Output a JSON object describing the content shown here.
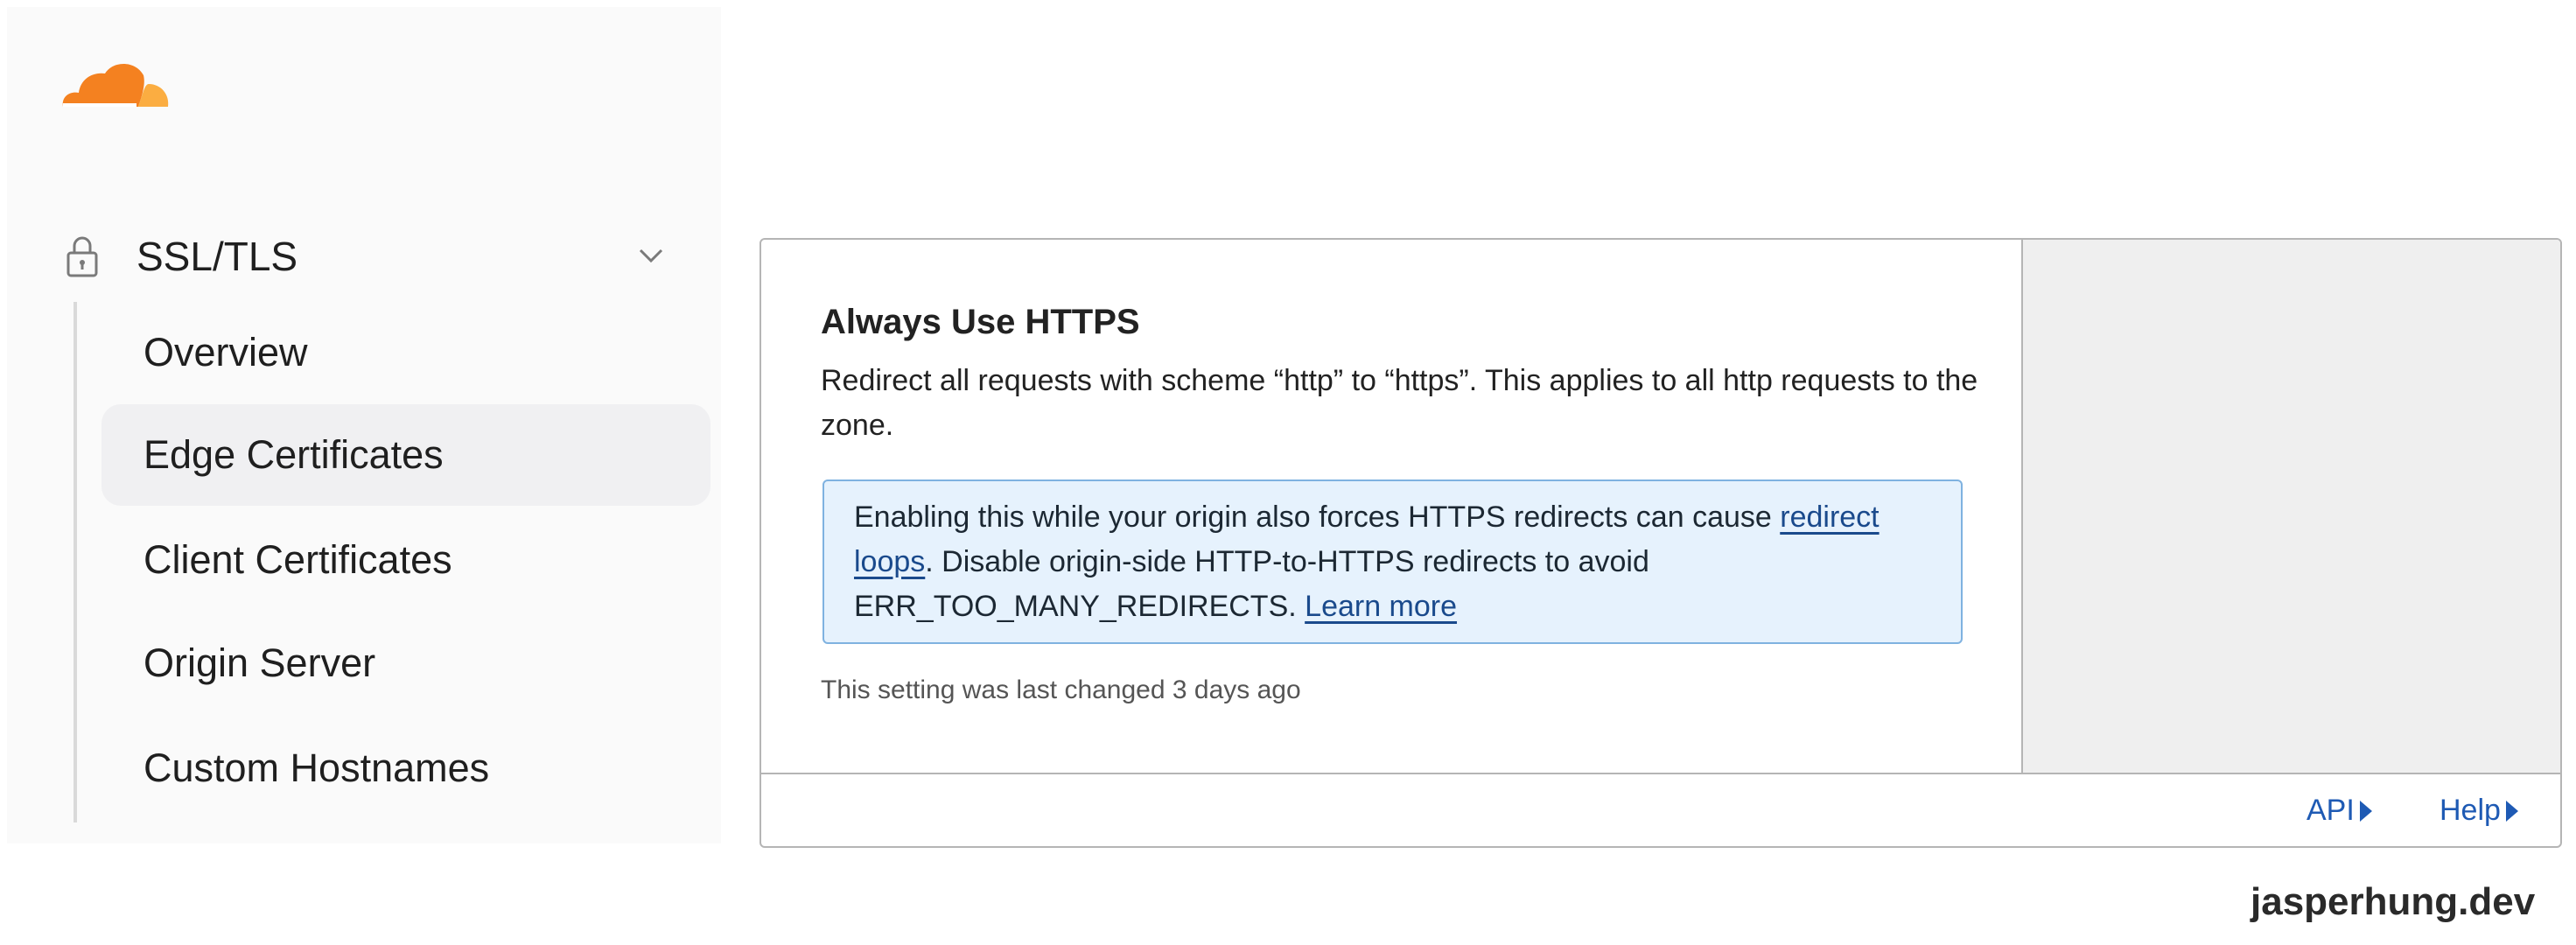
{
  "sidebar": {
    "section_label": "SSL/TLS",
    "items": [
      {
        "label": "Overview",
        "active": false
      },
      {
        "label": "Edge Certificates",
        "active": true
      },
      {
        "label": "Client Certificates",
        "active": false
      },
      {
        "label": "Origin Server",
        "active": false
      },
      {
        "label": "Custom Hostnames",
        "active": false
      }
    ]
  },
  "card": {
    "title": "Always Use HTTPS",
    "description": "Redirect all requests with scheme “http” to “https”. This applies to all http requests to the zone.",
    "callout": {
      "text_before": "Enabling this while your origin also forces HTTPS redirects can cause ",
      "link1": "redirect loops",
      "text_middle": ". Disable origin-side HTTP-to-HTTPS redirects to avoid ERR_TOO_MANY_REDIRECTS. ",
      "link2": "Learn more"
    },
    "last_changed": "This setting was last changed 3 days ago",
    "toggle": {
      "state": "on"
    },
    "footer": {
      "api_label": "API",
      "help_label": "Help"
    }
  },
  "watermark": "jasperhung.dev",
  "colors": {
    "brand_orange": "#f48120",
    "toggle_green": "#1f7a3e",
    "link_blue": "#1e5ab4",
    "callout_bg": "#e6f2fd",
    "arrow_pink": "#ec4b8c"
  }
}
